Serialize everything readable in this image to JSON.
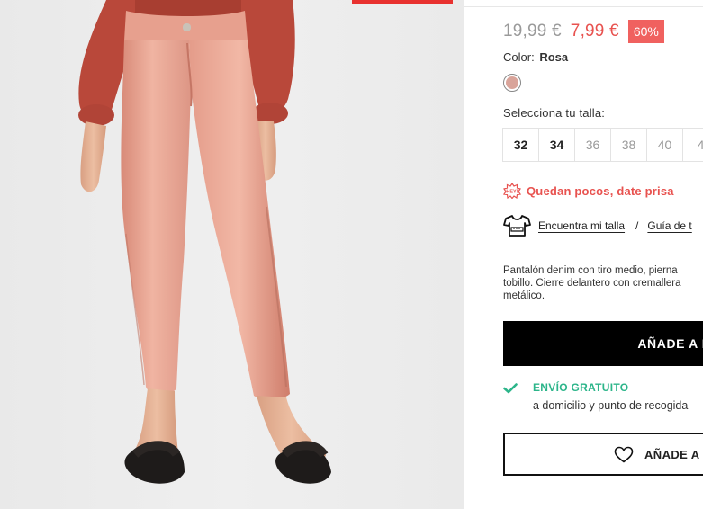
{
  "product": {
    "price_old": "19,99 €",
    "price_new": "7,99 €",
    "discount": "60%",
    "color_label": "Color:",
    "color_name": "Rosa",
    "color_swatch": "#d9a49a",
    "size_label": "Selecciona tu talla:",
    "sizes": [
      "32",
      "34",
      "36",
      "38",
      "40",
      "4"
    ],
    "sizes_available": [
      "32",
      "34"
    ],
    "hurry_badge": "HEY!",
    "hurry_text": "Quedan pocos, date prisa",
    "fit_link": "Encuentra mi talla",
    "separator": "/",
    "guide_link": "Guía de t",
    "description_lines": [
      "Pantalón denim con tiro medio, pierna",
      "tobillo. Cierre delantero con cremallera",
      "metálico."
    ],
    "add_to_bag": "AÑADE A LA",
    "shipping_title": "ENVÍO GRATUITO",
    "shipping_sub": "a domicilio y punto de recogida",
    "wishlist": "AÑADE A W"
  },
  "icons": {
    "tshirt": "tshirt-icon",
    "heart": "heart-icon",
    "check": "check-icon",
    "hey": "hey-badge-icon"
  },
  "colors": {
    "accent": "#e8524f",
    "discount_bg": "#f0615f",
    "success": "#2cb58a",
    "button": "#000000"
  }
}
